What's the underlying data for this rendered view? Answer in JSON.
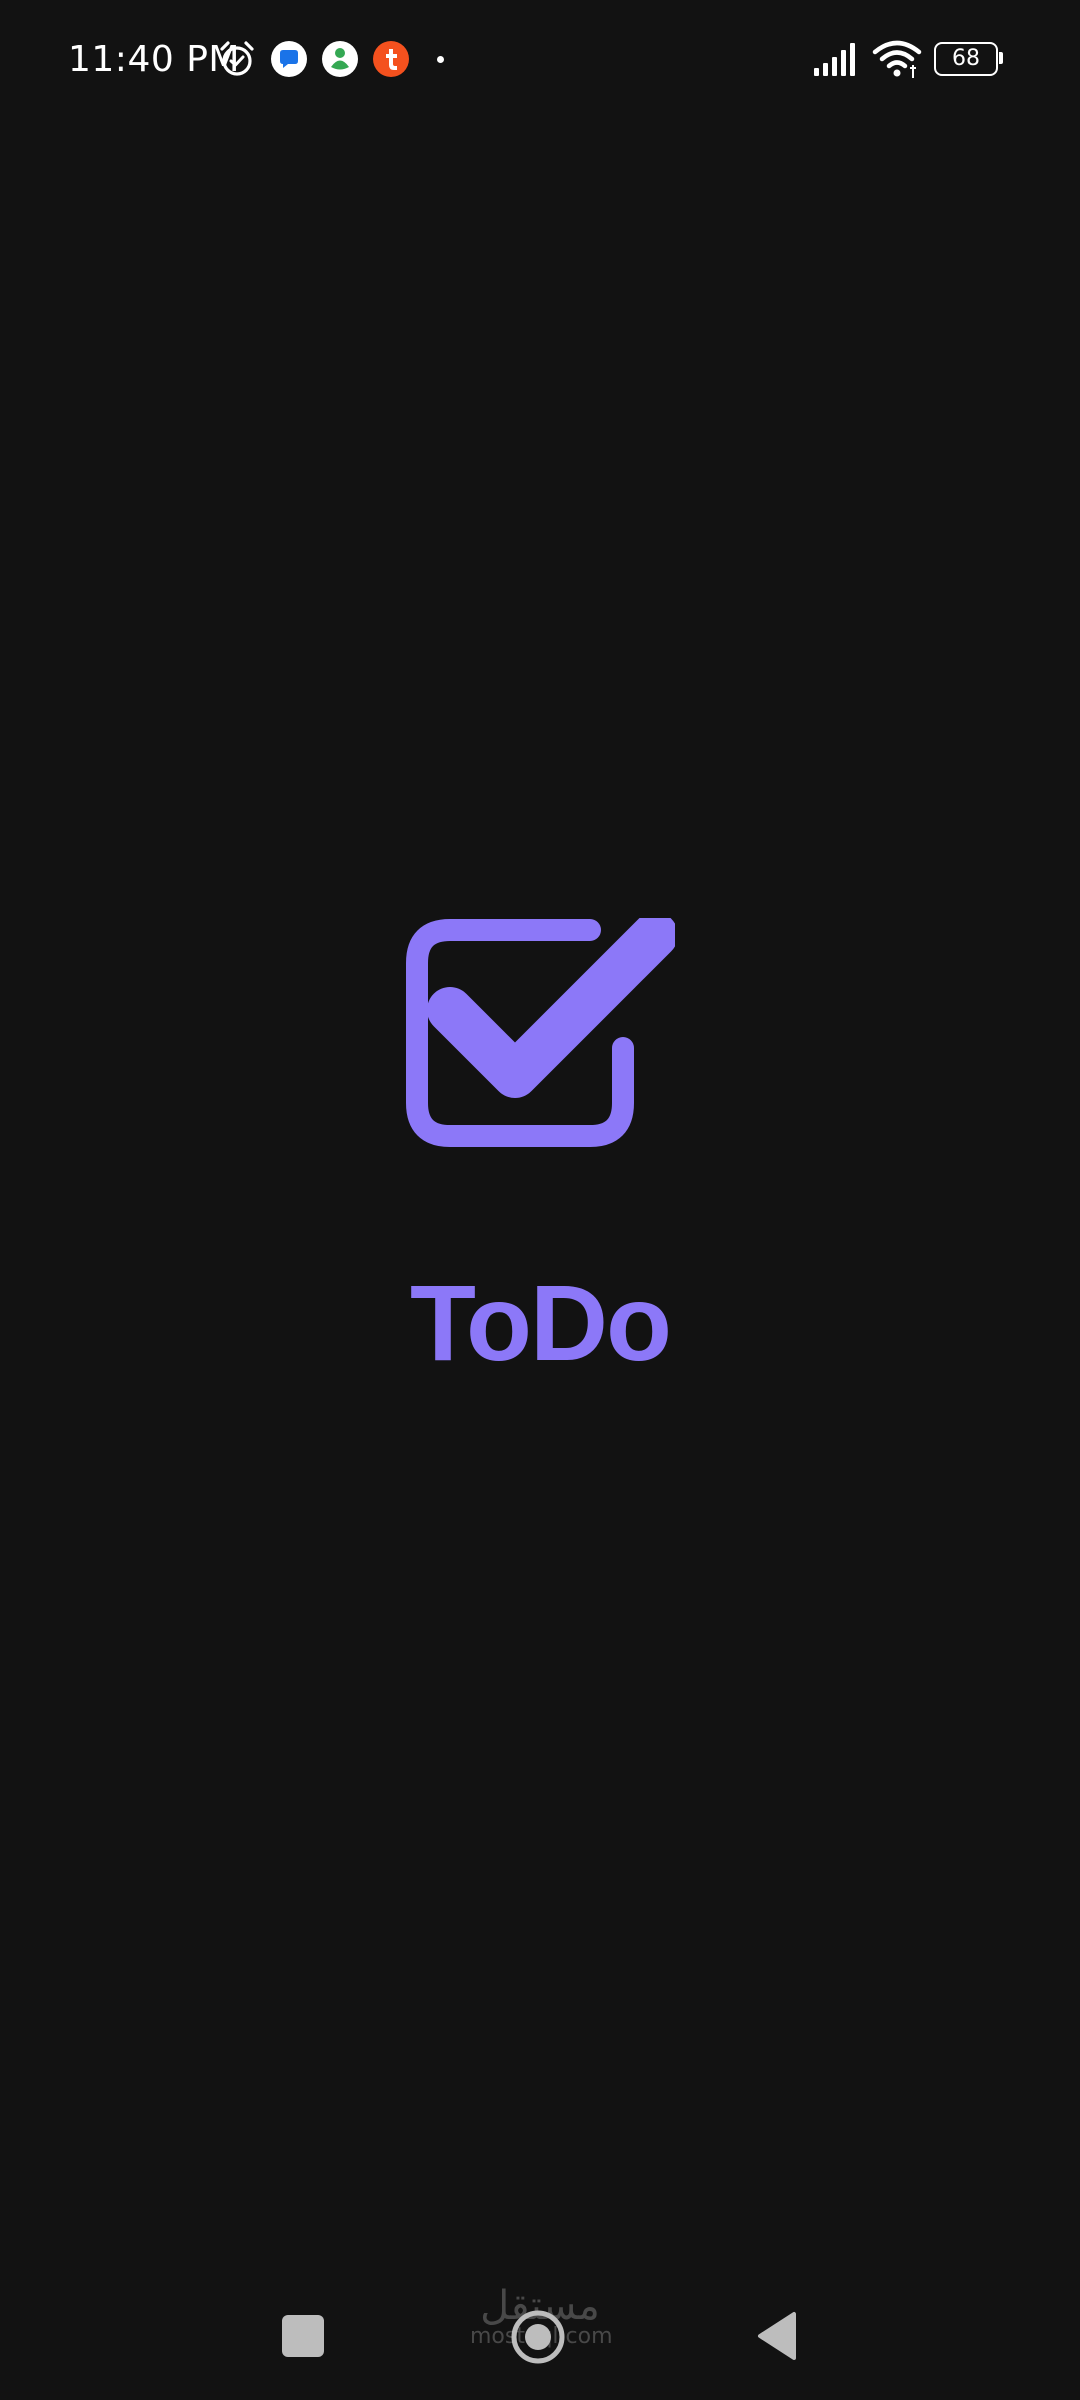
{
  "status_bar": {
    "time": "11:40 PM",
    "notification_icons": [
      "alarm-icon",
      "messages-icon",
      "contacts-icon",
      "tumblr-icon",
      "more-dot-icon"
    ],
    "battery_level": "68",
    "system_icons": [
      "signal-icon",
      "wifi-icon",
      "battery-icon"
    ]
  },
  "splash": {
    "logo_icon": "checkbox-checked-icon",
    "title": "ToDo",
    "accent_color": "#8c78f8",
    "background_color": "#121212"
  },
  "watermark": {
    "arabic": "مستقل",
    "latin": "mostaql.com"
  },
  "nav_bar": {
    "buttons": [
      "recents-button",
      "home-button",
      "back-button"
    ]
  }
}
